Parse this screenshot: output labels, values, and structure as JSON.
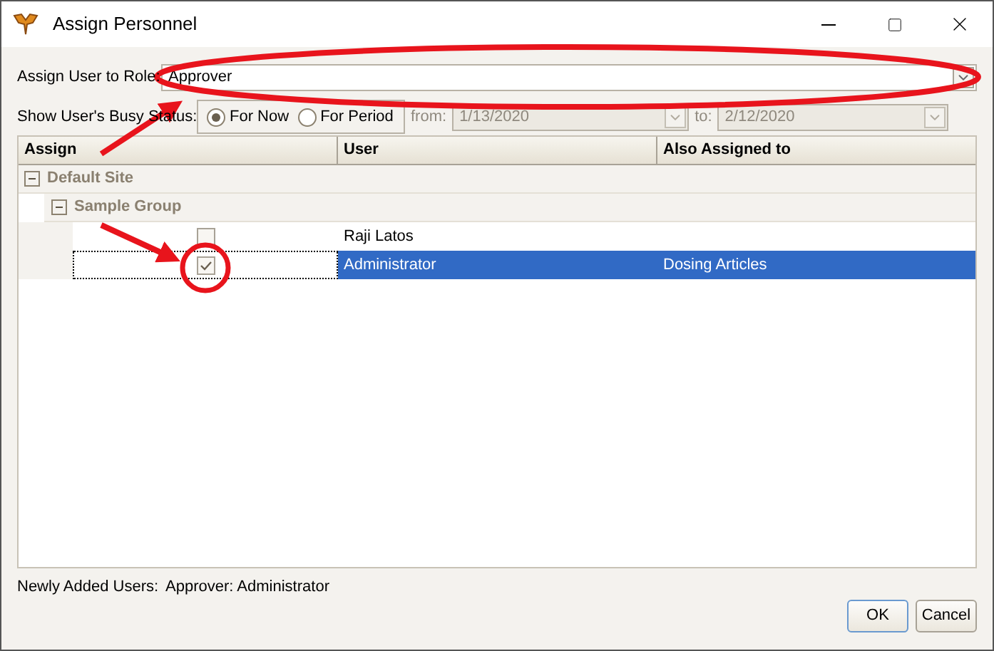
{
  "window": {
    "title": "Assign Personnel"
  },
  "role": {
    "label": "Assign User to Role:",
    "value": "Approver"
  },
  "busy_status": {
    "label": "Show User's Busy Status:",
    "options": [
      {
        "label": "For Now",
        "selected": true
      },
      {
        "label": "For Period",
        "selected": false
      }
    ],
    "from_label": "from:",
    "from_value": "1/13/2020",
    "to_label": "to:",
    "to_value": "2/12/2020",
    "disabled": true
  },
  "table": {
    "columns": [
      "Assign",
      "User",
      "Also Assigned to"
    ],
    "tree": [
      {
        "name": "Default Site",
        "expanded": true,
        "children": [
          {
            "name": "Sample Group",
            "expanded": true,
            "users": [
              {
                "user": "Raji Latos",
                "checked": false,
                "selected": false
              },
              {
                "user": "Administrator",
                "checked": true,
                "selected": true,
                "also_assigned": "Dosing Articles"
              }
            ]
          }
        ]
      }
    ]
  },
  "footer": {
    "label": "Newly Added Users:",
    "value": "Approver: Administrator"
  },
  "buttons": [
    "OK",
    "Cancel"
  ]
}
